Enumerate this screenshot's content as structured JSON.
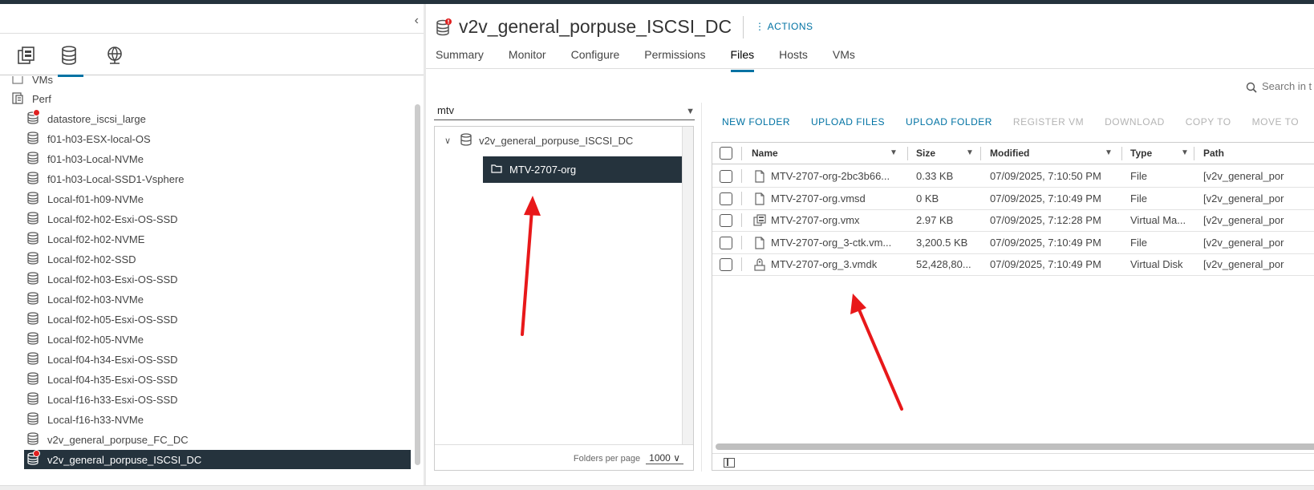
{
  "nav": {
    "tabs": [
      {
        "icon": "hosts-clusters-icon"
      },
      {
        "icon": "storage-icon",
        "active": true
      },
      {
        "icon": "networking-icon"
      }
    ],
    "tree": [
      {
        "label": "VMs",
        "icon": "folder-checkbox-icon"
      },
      {
        "label": "Perf",
        "icon": "datacenter-icon"
      },
      {
        "label": "datastore_iscsi_large",
        "icon": "datastore-icon",
        "alert": true
      },
      {
        "label": "f01-h03-ESX-local-OS",
        "icon": "datastore-icon"
      },
      {
        "label": "f01-h03-Local-NVMe",
        "icon": "datastore-icon"
      },
      {
        "label": "f01-h03-Local-SSD1-Vsphere",
        "icon": "datastore-icon"
      },
      {
        "label": "Local-f01-h09-NVMe",
        "icon": "datastore-icon"
      },
      {
        "label": "Local-f02-h02-Esxi-OS-SSD",
        "icon": "datastore-icon"
      },
      {
        "label": "Local-f02-h02-NVME",
        "icon": "datastore-icon"
      },
      {
        "label": "Local-f02-h02-SSD",
        "icon": "datastore-icon"
      },
      {
        "label": "Local-f02-h03-Esxi-OS-SSD",
        "icon": "datastore-icon"
      },
      {
        "label": "Local-f02-h03-NVMe",
        "icon": "datastore-icon"
      },
      {
        "label": "Local-f02-h05-Esxi-OS-SSD",
        "icon": "datastore-icon"
      },
      {
        "label": "Local-f02-h05-NVMe",
        "icon": "datastore-icon"
      },
      {
        "label": "Local-f04-h34-Esxi-OS-SSD",
        "icon": "datastore-icon"
      },
      {
        "label": "Local-f04-h35-Esxi-OS-SSD",
        "icon": "datastore-icon"
      },
      {
        "label": "Local-f16-h33-Esxi-OS-SSD",
        "icon": "datastore-icon"
      },
      {
        "label": "Local-f16-h33-NVMe",
        "icon": "datastore-icon"
      },
      {
        "label": "v2v_general_porpuse_FC_DC",
        "icon": "datastore-icon"
      },
      {
        "label": "v2v_general_porpuse_ISCSI_DC",
        "icon": "datastore-icon",
        "alert": true,
        "selected": true
      }
    ]
  },
  "header": {
    "title": "v2v_general_porpuse_ISCSI_DC",
    "actions": "ACTIONS",
    "tabs": [
      "Summary",
      "Monitor",
      "Configure",
      "Permissions",
      "Files",
      "Hosts",
      "VMs"
    ],
    "active_tab": "Files"
  },
  "search": {
    "placeholder": "Search in t"
  },
  "folders": {
    "filter_value": "mtv",
    "root": "v2v_general_porpuse_ISCSI_DC",
    "child": "MTV-2707-org",
    "per_page_label": "Folders per page",
    "per_page_value": "1000"
  },
  "toolbar": {
    "new_folder": "NEW FOLDER",
    "upload_files": "UPLOAD FILES",
    "upload_folder": "UPLOAD FOLDER",
    "register_vm": "REGISTER VM",
    "download": "DOWNLOAD",
    "copy_to": "COPY TO",
    "move_to": "MOVE TO",
    "more": "RE"
  },
  "grid": {
    "columns": [
      "Name",
      "Size",
      "Modified",
      "Type",
      "Path"
    ],
    "rows": [
      {
        "name": "MTV-2707-org-2bc3b66...",
        "size": "0.33 KB",
        "modified": "07/09/2025, 7:10:50 PM",
        "type": "File",
        "path": "[v2v_general_por",
        "icon": "file-icon"
      },
      {
        "name": "MTV-2707-org.vmsd",
        "size": "0 KB",
        "modified": "07/09/2025, 7:10:49 PM",
        "type": "File",
        "path": "[v2v_general_por",
        "icon": "file-icon"
      },
      {
        "name": "MTV-2707-org.vmx",
        "size": "2.97 KB",
        "modified": "07/09/2025, 7:12:28 PM",
        "type": "Virtual Ma...",
        "path": "[v2v_general_por",
        "icon": "vm-icon"
      },
      {
        "name": "MTV-2707-org_3-ctk.vm...",
        "size": "3,200.5 KB",
        "modified": "07/09/2025, 7:10:49 PM",
        "type": "File",
        "path": "[v2v_general_por",
        "icon": "file-icon"
      },
      {
        "name": "MTV-2707-org_3.vmdk",
        "size": "52,428,80...",
        "modified": "07/09/2025, 7:10:49 PM",
        "type": "Virtual Disk",
        "path": "[v2v_general_por",
        "icon": "disk-icon"
      }
    ]
  },
  "colors": {
    "accent": "#0072a3",
    "selected_bg": "#25333d",
    "alert": "#e02020",
    "arrow": "#e8181a"
  }
}
